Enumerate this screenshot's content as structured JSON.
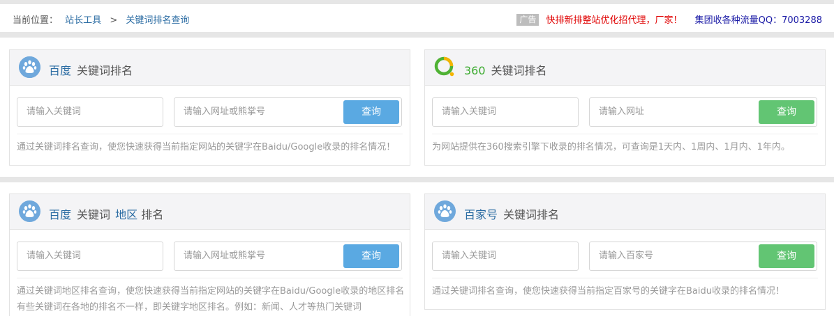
{
  "breadcrumb": {
    "label": "当前位置：",
    "link1": "站长工具",
    "separator": ">",
    "current": "关键词排名查询"
  },
  "ad": {
    "tag": "广告",
    "text": "快排新排整站优化招代理，厂家！",
    "qq": "集团收各种流量QQ：7003288"
  },
  "cards": [
    {
      "brand": "百度",
      "title": "关键词排名",
      "keyword_placeholder": "请输入关键词",
      "url_placeholder": "请输入网址或熊掌号",
      "button": "查询",
      "description": "通过关键词排名查询，使您快速获得当前指定网站的关键字在Baidu/Google收录的排名情况！"
    },
    {
      "brand": "360",
      "title": "关键词排名",
      "keyword_placeholder": "请输入关键词",
      "url_placeholder": "请输入网址",
      "button": "查询",
      "description": "为网站提供在360搜索引擎下收录的排名情况，可查询是1天内、1周内、1月内、1年内。"
    },
    {
      "brand": "百度",
      "title_pre": "关键词",
      "title_mid": "地区",
      "title_post": "排名",
      "keyword_placeholder": "请输入关键词",
      "url_placeholder": "请输入网址或熊掌号",
      "button": "查询",
      "description_line1": "通过关键词地区排名查询，使您快速获得当前指定网站的关键字在Baidu/Google收录的地区排名",
      "description_line2": "有些关键词在各地的排名不一样，即关键字地区排名。例如：新闻、人才等热门关键词"
    },
    {
      "brand": "百家号",
      "title": "关键词排名",
      "keyword_placeholder": "请输入关键词",
      "url_placeholder": "请输入百家号",
      "button": "查询",
      "description": "通过关键词排名查询，使您快速获得当前指定百家号的关键字在Baidu收录的排名情况！"
    }
  ],
  "colors": {
    "link_blue": "#2b6ca3",
    "button_blue": "#5aa9e2",
    "button_green": "#62c573",
    "ad_red": "#e00000",
    "qq_blue": "#1a1aa6"
  },
  "icons": [
    "baidu-paw-icon",
    "360-search-icon",
    "baidu-paw-icon",
    "baijiahao-paw-icon"
  ]
}
